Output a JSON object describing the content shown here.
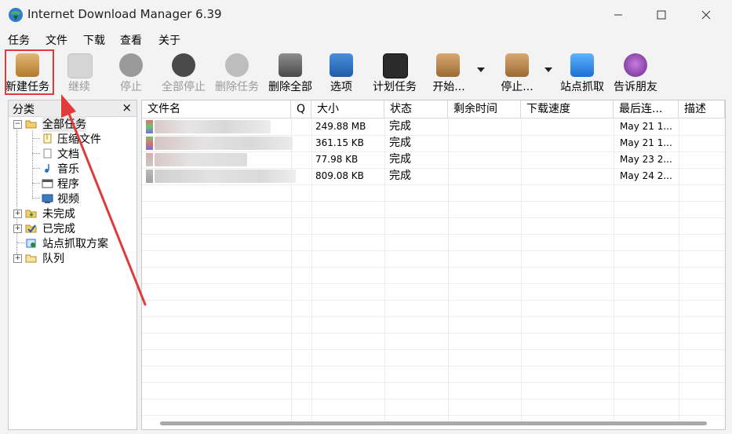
{
  "window": {
    "title": "Internet Download Manager 6.39"
  },
  "menu": [
    "任务",
    "文件",
    "下载",
    "查看",
    "关于"
  ],
  "toolbar": {
    "buttons": [
      {
        "label": "新建任务",
        "icon": "new-task-icon",
        "enabled": true
      },
      {
        "label": "继续",
        "icon": "resume-icon",
        "enabled": false
      },
      {
        "label": "停止",
        "icon": "stop-icon",
        "enabled": false
      },
      {
        "label": "全部停止",
        "icon": "stop-all-icon",
        "enabled": false
      },
      {
        "label": "删除任务",
        "icon": "delete-task-icon",
        "enabled": false
      },
      {
        "label": "删除全部",
        "icon": "delete-all-icon",
        "enabled": true
      },
      {
        "label": "选项",
        "icon": "options-icon",
        "enabled": true
      },
      {
        "label": "计划任务",
        "icon": "scheduler-icon",
        "enabled": true
      },
      {
        "label": "开始...",
        "icon": "start-queue-icon",
        "enabled": true
      },
      {
        "label": "停止...",
        "icon": "stop-queue-icon",
        "enabled": true
      },
      {
        "label": "站点抓取",
        "icon": "site-grabber-icon",
        "enabled": true
      },
      {
        "label": "告诉朋友",
        "icon": "tell-friend-icon",
        "enabled": true
      }
    ]
  },
  "sidebar": {
    "title": "分类",
    "close": "×",
    "tree": {
      "all": "全部任务",
      "children": [
        "压缩文件",
        "文档",
        "音乐",
        "程序",
        "视频"
      ],
      "unfinished": "未完成",
      "finished": "已完成",
      "grabber": "站点抓取方案",
      "queue": "队列"
    }
  },
  "list": {
    "columns": [
      "文件名",
      "Q",
      "大小",
      "状态",
      "剩余时间",
      "下载速度",
      "最后连...",
      "描述"
    ],
    "rows": [
      {
        "size": "249.88  MB",
        "status": "完成",
        "last": "May 21 1..."
      },
      {
        "size": "361.15  KB",
        "status": "完成",
        "last": "May 21 1..."
      },
      {
        "size": "77.98  KB",
        "status": "完成",
        "last": "May 23 2..."
      },
      {
        "size": "809.08  KB",
        "status": "完成",
        "last": "May 24 2..."
      }
    ]
  },
  "colors": {
    "accent_red": "#e03a3a"
  }
}
